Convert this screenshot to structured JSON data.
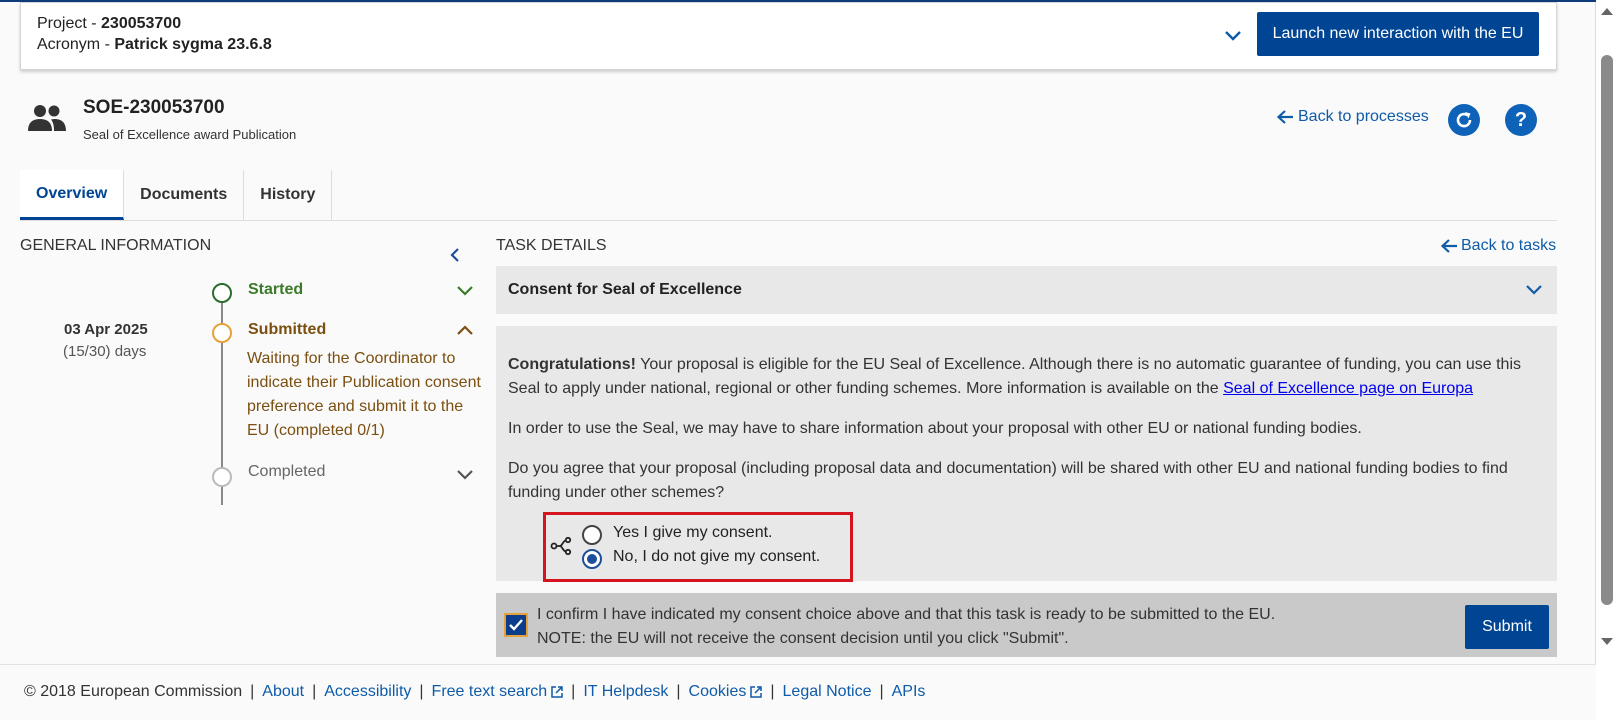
{
  "project": {
    "project_label": "Project - ",
    "project_value": "230053700",
    "acronym_label": "Acronym - ",
    "acronym_value": "Patrick sygma 23.6.8",
    "launch_button": "Launch new interaction with the EU"
  },
  "process": {
    "title": "SOE-230053700",
    "subtitle": "Seal of Excellence award Publication",
    "back_to_processes": "Back to processes",
    "refresh_icon": "refresh-icon",
    "help_symbol": "?"
  },
  "tabs": [
    {
      "label": "Overview",
      "active": true
    },
    {
      "label": "Documents",
      "active": false
    },
    {
      "label": "History",
      "active": false
    }
  ],
  "general_info": {
    "title": "GENERAL INFORMATION",
    "date": "03 Apr 2025",
    "days": "(15/30) days",
    "steps": [
      {
        "label": "Started",
        "state": "done"
      },
      {
        "label": "Submitted",
        "state": "current"
      },
      {
        "label": "Completed",
        "state": "pending"
      }
    ],
    "submitted_description": "Waiting for the Coordinator to indicate their Publication consent preference and submit it to the EU (completed 0/1)"
  },
  "task": {
    "title": "TASK DETAILS",
    "back_to_tasks": "Back to tasks",
    "consent_header": "Consent for Seal of Excellence",
    "congrats_bold": "Congratulations!",
    "congrats_text": " Your proposal is eligible for the EU Seal of Excellence. Although there is no automatic guarantee of funding, you can use this Seal to apply under national, regional or other funding schemes. More information is available on the ",
    "seal_link": "Seal of Excellence page on Europa",
    "share_text": "In order to use the Seal, we may have to share information about your proposal with other EU or national funding bodies.",
    "question": "Do you agree that your proposal (including proposal data and documentation) will be shared with other EU and national funding bodies to find funding under other schemes?",
    "option_yes": "Yes I give my consent.",
    "option_no": "No, I do not give my consent.",
    "selected_option": "no",
    "confirm_line1": "I confirm I have indicated my consent choice above and that this task is ready to be submitted to the EU.",
    "confirm_line2": "NOTE: the EU will not receive the consent decision until you click \"Submit\".",
    "confirm_checked": true,
    "submit_button": "Submit"
  },
  "footer": {
    "copyright": "© 2018 European Commission",
    "links": [
      "About",
      "Accessibility",
      "Free text search",
      "IT Helpdesk",
      "Cookies",
      "Legal Notice",
      "APIs"
    ]
  },
  "colors": {
    "primary": "#004494",
    "link": "#0e5ba8",
    "started": "#3b7a2a",
    "submitted": "#7a4f10",
    "highlight": "#d4141e"
  }
}
